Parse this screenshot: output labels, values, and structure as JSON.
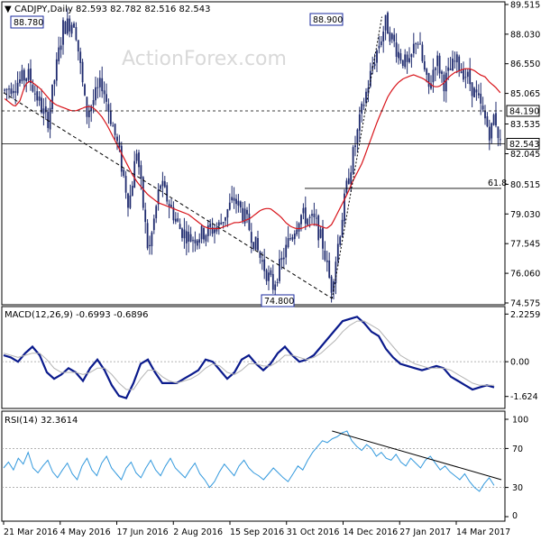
{
  "colors": {
    "candle": "#1e2a6e",
    "ma": "#d8141a",
    "macd": "#0a1a8c",
    "signal": "#b3b3b3",
    "rsi": "#3399dd",
    "trendline": "#000000",
    "frame": "#000000",
    "background": "#ffffff"
  },
  "header": {
    "title": "CADJPY,Daily",
    "ohlc": "82.593 82.782 82.516 82.543"
  },
  "watermark": "ActionForex.com",
  "chart_data": [
    {
      "type": "candlestick",
      "name": "CADJPY,Daily",
      "ylim": [
        74.575,
        89.515
      ],
      "y_ticks": [
        89.515,
        88.03,
        86.55,
        85.065,
        83.535,
        82.045,
        80.515,
        79.03,
        77.545,
        76.06,
        74.575
      ],
      "x_ticks": [
        "21 Mar 2016",
        "4 May 2016",
        "17 Jun 2016",
        "2 Aug 2016",
        "15 Sep 2016",
        "31 Oct 2016",
        "14 Dec 2016",
        "27 Jan 2017",
        "14 Mar 2017"
      ],
      "ma_series": [
        84.8,
        84.6,
        84.4,
        84.7,
        85.5,
        85.7,
        85.5,
        85.3,
        85.0,
        84.7,
        84.5,
        84.4,
        84.3,
        84.2,
        84.2,
        84.3,
        84.4,
        84.4,
        84.2,
        83.9,
        83.5,
        83.0,
        82.5,
        82.0,
        81.5,
        81.0,
        80.6,
        80.3,
        80.0,
        79.8,
        79.6,
        79.5,
        79.4,
        79.3,
        79.2,
        79.1,
        79.0,
        78.8,
        78.6,
        78.4,
        78.3,
        78.3,
        78.3,
        78.4,
        78.5,
        78.6,
        78.6,
        78.7,
        78.8,
        79.0,
        79.2,
        79.3,
        79.3,
        79.1,
        78.9,
        78.6,
        78.4,
        78.3,
        78.3,
        78.4,
        78.5,
        78.5,
        78.4,
        78.3,
        78.5,
        79.0,
        79.5,
        80.0,
        80.6,
        81.1,
        81.6,
        82.3,
        83.0,
        83.7,
        84.3,
        84.9,
        85.3,
        85.6,
        85.8,
        85.9,
        86.0,
        85.9,
        85.8,
        85.6,
        85.4,
        85.4,
        85.6,
        85.9,
        86.1,
        86.2,
        86.3,
        86.3,
        86.2,
        86.0,
        85.9,
        85.6,
        85.4,
        85.1
      ],
      "levels": [
        {
          "label": "84.190",
          "value": 84.19,
          "style": "dashed"
        },
        {
          "label": "82.543",
          "value": 82.543,
          "style": "solid"
        },
        {
          "label": "61.8",
          "value": 80.31,
          "style": "solid"
        }
      ],
      "annotations": [
        {
          "label": "88.780",
          "value": 88.78
        },
        {
          "label": "88.900",
          "value": 88.9
        },
        {
          "label": "74.800",
          "value": 74.8
        }
      ],
      "trendlines": [
        {
          "from": [
            0,
            85.1
          ],
          "to": [
            66,
            74.8
          ],
          "style": "dashed"
        },
        {
          "from": [
            66,
            74.8
          ],
          "to": [
            76,
            88.9
          ],
          "style": "dotted"
        }
      ]
    },
    {
      "type": "line",
      "name": "MACD(12,26,9) -0.6993 -0.6896",
      "label": "MACD(12,26,9)",
      "values_text": "-0.6993 -0.6896",
      "ylim": [
        -2.1,
        2.45
      ],
      "y_ticks": [
        "2.2259",
        "0.00",
        "-1.624"
      ],
      "series": [
        {
          "values": [
            0.3,
            0.2,
            0.0,
            0.4,
            0.7,
            0.3,
            -0.5,
            -0.8,
            -0.6,
            -0.3,
            -0.5,
            -0.9,
            -0.3,
            0.1,
            -0.4,
            -1.1,
            -1.6,
            -1.7,
            -1.0,
            -0.1,
            0.1,
            -0.5,
            -1.0,
            -1.0,
            -1.0,
            -0.8,
            -0.6,
            -0.4,
            0.1,
            0.0,
            -0.4,
            -0.8,
            -0.5,
            0.1,
            0.3,
            -0.1,
            -0.4,
            -0.1,
            0.4,
            0.7,
            0.3,
            0.0,
            0.1,
            0.3,
            0.7,
            1.1,
            1.5,
            1.9,
            2.0,
            2.1,
            1.8,
            1.4,
            1.2,
            0.6,
            0.2,
            -0.1,
            -0.2,
            -0.3,
            -0.4,
            -0.3,
            -0.2,
            -0.3,
            -0.7,
            -0.9,
            -1.1,
            -1.3,
            -1.2,
            -1.1,
            -1.2
          ]
        },
        {
          "values": [
            0.4,
            0.3,
            0.2,
            0.3,
            0.4,
            0.4,
            0.1,
            -0.3,
            -0.5,
            -0.5,
            -0.5,
            -0.6,
            -0.5,
            -0.3,
            -0.3,
            -0.6,
            -1.0,
            -1.3,
            -1.3,
            -0.8,
            -0.4,
            -0.4,
            -0.7,
            -0.9,
            -1.0,
            -0.9,
            -0.8,
            -0.6,
            -0.3,
            -0.1,
            -0.2,
            -0.5,
            -0.6,
            -0.4,
            -0.1,
            -0.1,
            -0.2,
            -0.2,
            0.0,
            0.3,
            0.3,
            0.2,
            0.1,
            0.2,
            0.4,
            0.7,
            1.0,
            1.4,
            1.7,
            1.9,
            1.9,
            1.7,
            1.5,
            1.1,
            0.7,
            0.3,
            0.1,
            -0.1,
            -0.2,
            -0.3,
            -0.3,
            -0.3,
            -0.4,
            -0.6,
            -0.8,
            -1.0,
            -1.1,
            -1.1,
            -1.1
          ]
        }
      ]
    },
    {
      "type": "line",
      "name": "RSI(14) 32.3614",
      "label": "RSI(14)",
      "values_text": "32.3614",
      "ylim": [
        0,
        100
      ],
      "y_ticks": [
        100,
        70,
        30,
        0
      ],
      "series": [
        {
          "values": [
            50,
            56,
            48,
            60,
            54,
            66,
            50,
            45,
            52,
            58,
            46,
            40,
            48,
            55,
            44,
            38,
            52,
            60,
            48,
            42,
            55,
            62,
            50,
            44,
            38,
            50,
            56,
            45,
            40,
            50,
            58,
            48,
            42,
            52,
            60,
            50,
            45,
            40,
            48,
            55,
            44,
            38,
            30,
            36,
            46,
            54,
            48,
            42,
            52,
            58,
            50,
            45,
            42,
            38,
            44,
            50,
            45,
            40,
            36,
            44,
            52,
            48,
            58,
            66,
            72,
            78,
            76,
            80,
            82,
            86,
            88,
            78,
            72,
            68,
            74,
            70,
            62,
            66,
            60,
            58,
            64,
            56,
            52,
            60,
            55,
            50,
            58,
            62,
            55,
            48,
            52,
            46,
            42,
            38,
            44,
            36,
            30,
            26,
            34,
            40,
            32
          ]
        }
      ],
      "trendlines": [
        {
          "from": [
            66,
            88
          ],
          "to": [
            100,
            38
          ],
          "style": "solid"
        }
      ]
    }
  ]
}
